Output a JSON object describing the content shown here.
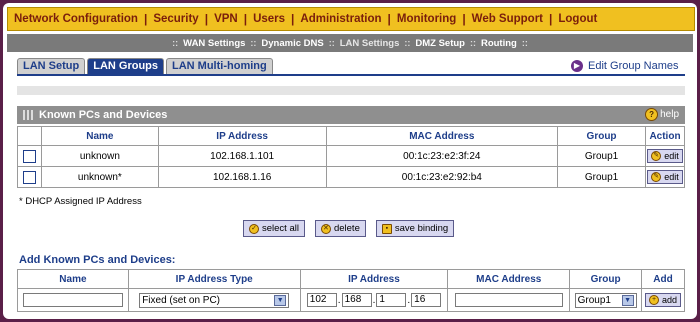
{
  "top_menu": [
    "Network Configuration",
    "Security",
    "VPN",
    "Users",
    "Administration",
    "Monitoring",
    "Web Support",
    "Logout"
  ],
  "sub_menu": [
    "WAN Settings",
    "Dynamic DNS",
    "LAN Settings",
    "DMZ Setup",
    "Routing"
  ],
  "tabs": [
    "LAN Setup",
    "LAN Groups",
    "LAN Multi-homing"
  ],
  "edit_group_names": "Edit Group Names",
  "known_panel": {
    "title": "Known PCs and Devices",
    "help": "help",
    "columns": [
      "Name",
      "IP Address",
      "MAC Address",
      "Group",
      "Action"
    ],
    "rows": [
      {
        "name": "unknown",
        "ip": "102.168.1.101",
        "mac": "00:1c:23:e2:3f:24",
        "group": "Group1",
        "action": "edit"
      },
      {
        "name": "unknown*",
        "ip": "102.168.1.16",
        "mac": "00:1c:23:e2:92:b4",
        "group": "Group1",
        "action": "edit"
      }
    ],
    "note": "* DHCP Assigned IP Address"
  },
  "buttons": {
    "select_all": "select all",
    "delete": "delete",
    "save_binding": "save binding"
  },
  "add_section": {
    "title": "Add Known PCs and Devices:",
    "columns": [
      "Name",
      "IP Address Type",
      "IP Address",
      "MAC Address",
      "Group",
      "Add"
    ],
    "name_value": "",
    "ip_type": "Fixed (set on PC)",
    "ip_octets": [
      "102",
      "168",
      "1",
      "16"
    ],
    "mac_value": "",
    "group": "Group1",
    "add_label": "add"
  },
  "colors": {
    "menu_bg": "#f0c020",
    "menu_text": "#7a1e0c",
    "accent": "#1e3e8a",
    "frame": "#5a1f48"
  }
}
